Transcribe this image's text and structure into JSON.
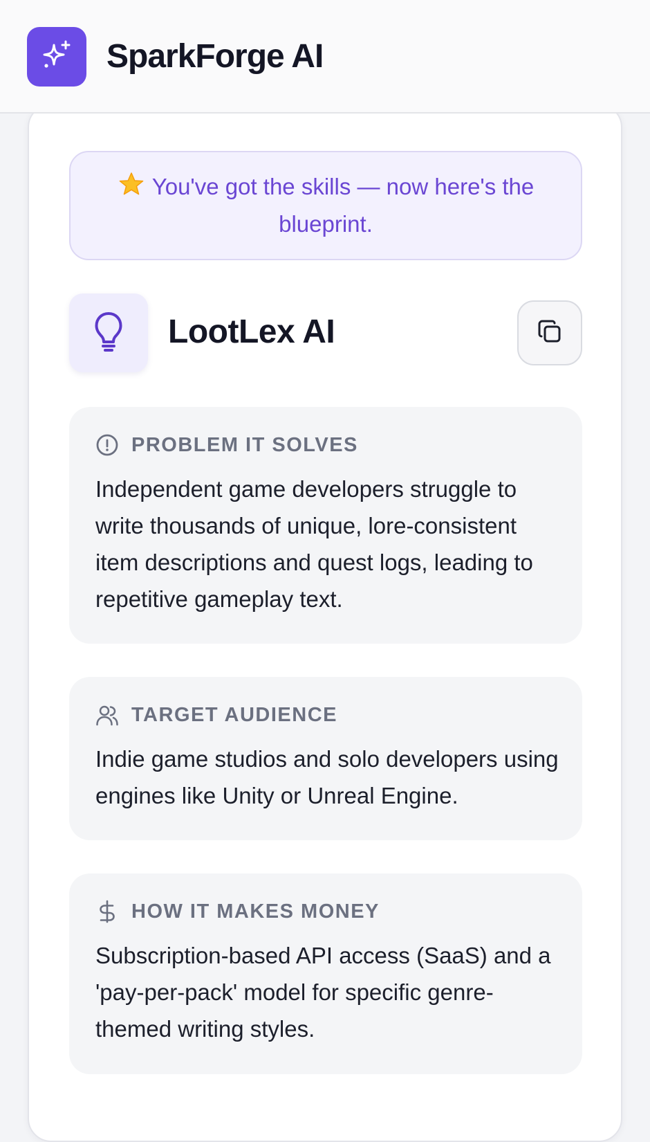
{
  "app": {
    "name": "SparkForge AI",
    "logo_icon": "sparkles-icon",
    "brand_color": "#6b4ce6"
  },
  "banner": {
    "icon": "star-icon",
    "text": "You've got the skills — now here's the blueprint."
  },
  "idea": {
    "icon": "lightbulb-icon",
    "name": "LootLex AI",
    "copy_icon": "copy-icon"
  },
  "sections": [
    {
      "icon": "alert-circle-icon",
      "label": "PROBLEM IT SOLVES",
      "text": "Independent game developers struggle to write thousands of unique, lore-consistent item descriptions and quest logs, leading to repetitive gameplay text."
    },
    {
      "icon": "users-icon",
      "label": "TARGET AUDIENCE",
      "text": "Indie game studios and solo developers using engines like Unity or Unreal Engine."
    },
    {
      "icon": "dollar-icon",
      "label": "HOW IT MAKES MONEY",
      "text": "Subscription-based API access (SaaS) and a 'pay-per-pack' model for specific genre-themed writing styles."
    }
  ]
}
